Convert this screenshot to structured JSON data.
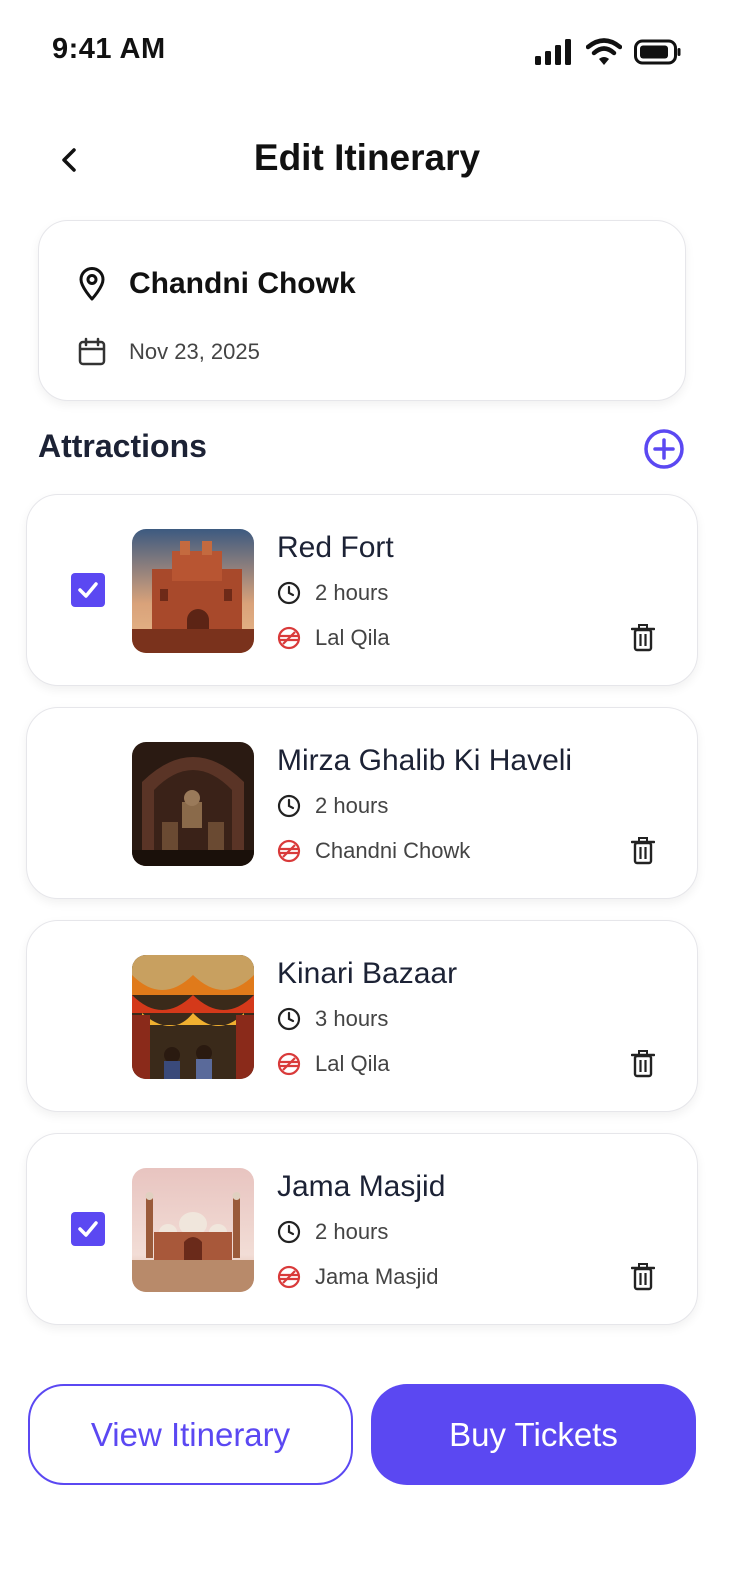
{
  "status_bar": {
    "time": "9:41 AM"
  },
  "header": {
    "title": "Edit Itinerary"
  },
  "trip": {
    "location": "Chandni Chowk",
    "date": "Nov 23, 2025"
  },
  "attractions_section": {
    "title": "Attractions"
  },
  "attractions": [
    {
      "name": "Red Fort",
      "duration": "2 hours",
      "metro_station": "Lal Qila",
      "selected": true
    },
    {
      "name": "Mirza Ghalib Ki Haveli",
      "duration": "2 hours",
      "metro_station": "Chandni Chowk",
      "selected": false
    },
    {
      "name": "Kinari Bazaar",
      "duration": "3 hours",
      "metro_station": "Lal Qila",
      "selected": false
    },
    {
      "name": "Jama Masjid",
      "duration": "2 hours",
      "metro_station": "Jama Masjid",
      "selected": true
    }
  ],
  "actions": {
    "view_itinerary_label": "View Itinerary",
    "buy_tickets_label": "Buy Tickets"
  },
  "colors": {
    "accent": "#5b48f2",
    "metro": "#d93a3a",
    "text": "#1c2235"
  }
}
